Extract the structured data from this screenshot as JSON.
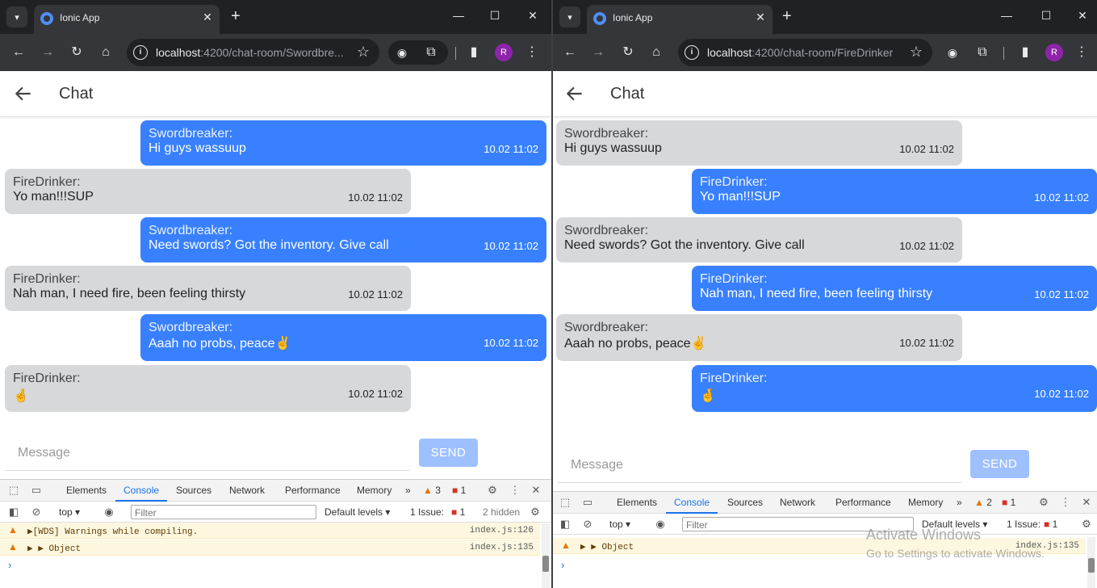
{
  "left": {
    "tab_title": "Ionic App",
    "url_host": "localhost",
    "url_path": ":4200/chat-room/Swordbre...",
    "avatar": "R",
    "page_title": "Chat",
    "messages": [
      {
        "author": "Swordbreaker:",
        "text": "Hi guys wassuup",
        "time": "10.02 11:02"
      },
      {
        "author": "FireDrinker:",
        "text": "Yo man!!!SUP",
        "time": "10.02 11:02"
      },
      {
        "author": "Swordbreaker:",
        "text": "Need swords? Got the inventory. Give call",
        "time": "10.02 11:02"
      },
      {
        "author": "FireDrinker:",
        "text": "Nah man, I need fire, been feeling thirsty",
        "time": "10.02 11:02"
      },
      {
        "author": "Swordbreaker:",
        "text": "Aaah no probs, peace✌",
        "time": "10.02 11:02"
      },
      {
        "author": "FireDrinker:",
        "text": "🤞",
        "time": "10.02 11:02"
      }
    ],
    "input_placeholder": "Message",
    "send_label": "SEND",
    "devtools": {
      "tabs": [
        "Elements",
        "Console",
        "Sources",
        "Network",
        "Performance",
        "Memory"
      ],
      "warn_count": "3",
      "err_count": "1",
      "context": "top",
      "filter_placeholder": "Filter",
      "levels": "Default levels",
      "issues_label": "1 Issue:",
      "issues_count": "1",
      "hidden": "2 hidden",
      "logs": [
        {
          "text": "▶[WDS] Warnings while compiling.",
          "src": "index.js:126"
        },
        {
          "text": "▶ ▶ Object",
          "src": "index.js:135"
        }
      ]
    }
  },
  "right": {
    "tab_title": "Ionic App",
    "url_host": "localhost",
    "url_path": ":4200/chat-room/FireDrinker",
    "avatar": "R",
    "page_title": "Chat",
    "messages": [
      {
        "author": "Swordbreaker:",
        "text": "Hi guys wassuup",
        "time": "10.02 11:02"
      },
      {
        "author": "FireDrinker:",
        "text": "Yo man!!!SUP",
        "time": "10.02 11:02"
      },
      {
        "author": "Swordbreaker:",
        "text": "Need swords? Got the inventory. Give call",
        "time": "10.02 11:02"
      },
      {
        "author": "FireDrinker:",
        "text": "Nah man, I need fire, been feeling thirsty",
        "time": "10.02 11:02"
      },
      {
        "author": "Swordbreaker:",
        "text": "Aaah no probs, peace✌",
        "time": "10.02 11:02"
      },
      {
        "author": "FireDrinker:",
        "text": "🤞",
        "time": "10.02 11:02"
      }
    ],
    "input_placeholder": "Message",
    "send_label": "SEND",
    "devtools": {
      "tabs": [
        "Elements",
        "Console",
        "Sources",
        "Network",
        "Performance",
        "Memory"
      ],
      "warn_count": "2",
      "err_count": "1",
      "context": "top",
      "filter_placeholder": "Filter",
      "levels": "Default levels",
      "issues_label": "1 Issue:",
      "issues_count": "1",
      "logs": [
        {
          "text": "▶ ▶ Object",
          "src": "index.js:135"
        }
      ]
    }
  },
  "watermark": {
    "line1": "Activate Windows",
    "line2": "Go to Settings to activate Windows."
  },
  "colors": {
    "own_bubble": "#3880ff",
    "other_bubble": "#d7d8da",
    "send_disabled": "#9ec0ff"
  }
}
